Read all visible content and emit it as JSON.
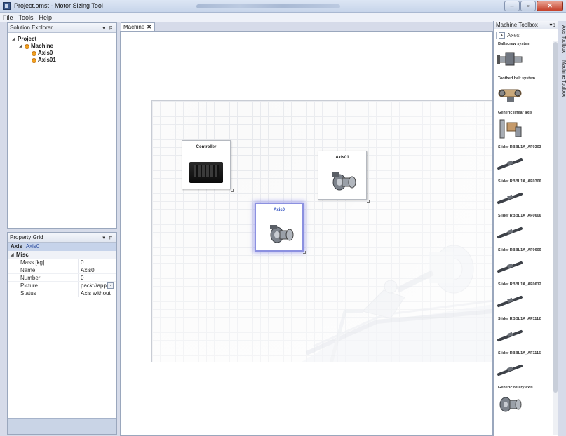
{
  "window": {
    "title": "Project.omst - Motor Sizing Tool",
    "buttons": {
      "minimize": "–",
      "maximize": "▫",
      "close": "✕"
    }
  },
  "menu": [
    "File",
    "Tools",
    "Help"
  ],
  "solution_explorer": {
    "title": "Solution Explorer",
    "tree": [
      {
        "label": "Project",
        "level": 0,
        "warning": false
      },
      {
        "label": "Machine",
        "level": 1,
        "warning": true
      },
      {
        "label": "Axis0",
        "level": 2,
        "warning": true
      },
      {
        "label": "Axis01",
        "level": 2,
        "warning": true
      }
    ]
  },
  "property_grid": {
    "title": "Property Grid",
    "object_type": "Axis",
    "object_name": "Axis0",
    "category": "Misc",
    "rows": [
      {
        "name": "Mass [kg]",
        "value": "0"
      },
      {
        "name": "Name",
        "value": "Axis0"
      },
      {
        "name": "Number",
        "value": "0"
      },
      {
        "name": "Picture",
        "value": "pack://app"
      },
      {
        "name": "Status",
        "value": "Axis without"
      }
    ]
  },
  "document": {
    "tab_label": "Machine",
    "tab_close": "✕",
    "nodes": {
      "controller": "Controller",
      "axis01": "Axis01",
      "axis0": "Axis0"
    }
  },
  "toolbox": {
    "title": "Machine Toolbox",
    "combo_label": "Axes",
    "combo_expander": "▴",
    "items": [
      "Ballscrew system",
      "Toothed belt system",
      "Generic linear axis",
      "Slider RBBL1A_AF0303",
      "Slider RBBL1A_AF0306",
      "Slider RBBL1A_AF0606",
      "Slider RBBL1A_AF0609",
      "Slider RBBL1A_AF0612",
      "Slider RBBL1A_AF1112",
      "Slider RBBL1A_AF1115",
      "Generic rotary axis"
    ]
  },
  "side_tabs": [
    "Axis Toolbox",
    "Machine Toolbox"
  ],
  "panel_controls": {
    "dropdown": "▾",
    "pin": "ᵽ"
  }
}
